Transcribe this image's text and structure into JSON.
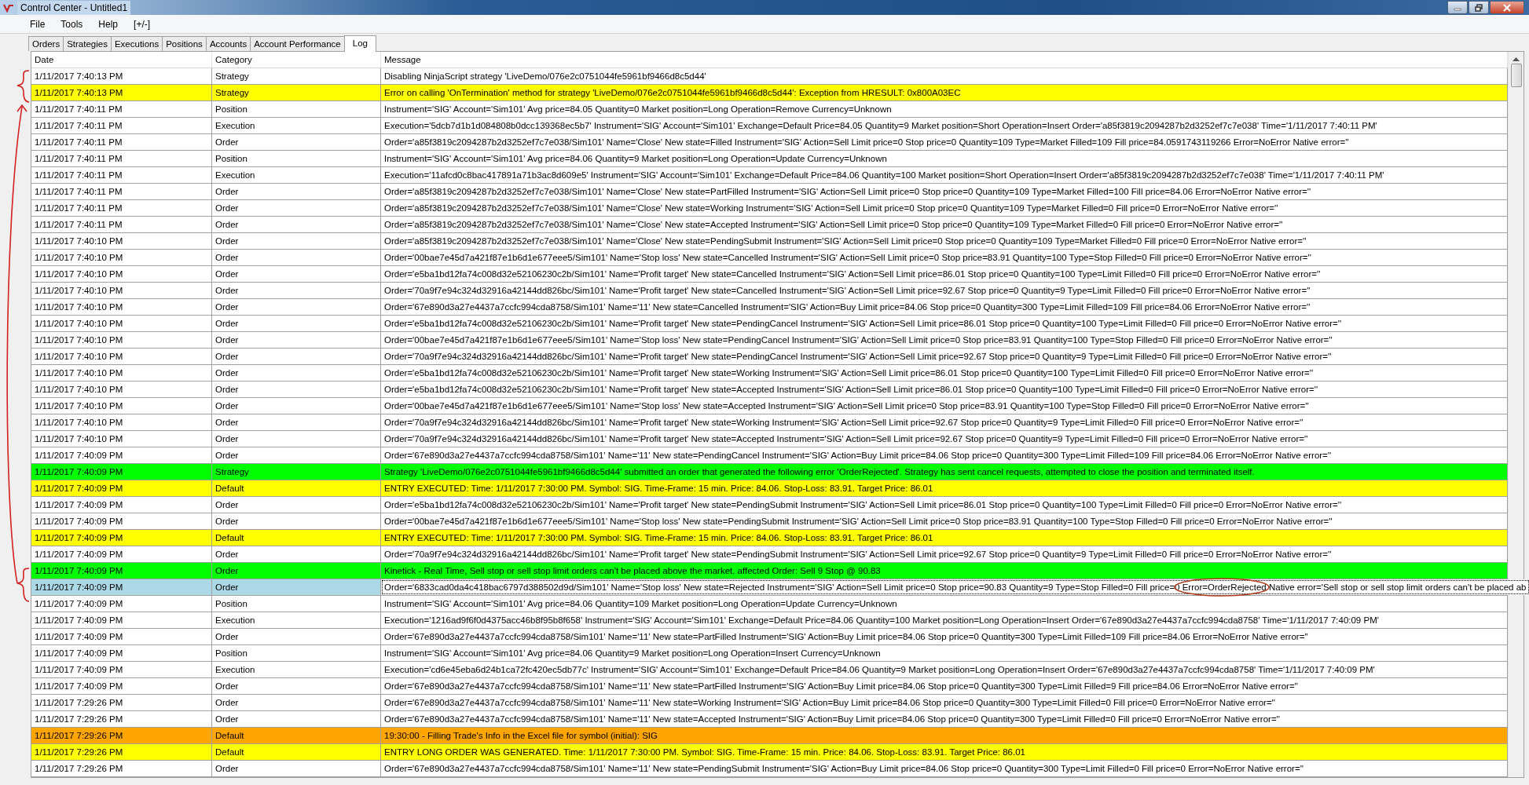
{
  "window": {
    "title": "Control Center - Untitled1"
  },
  "menu": [
    "File",
    "Tools",
    "Help",
    "[+/-]"
  ],
  "tabs": [
    {
      "label": "Orders",
      "selected": false
    },
    {
      "label": "Strategies",
      "selected": false
    },
    {
      "label": "Executions",
      "selected": false
    },
    {
      "label": "Positions",
      "selected": false
    },
    {
      "label": "Accounts",
      "selected": false
    },
    {
      "label": "Account Performance",
      "selected": false
    },
    {
      "label": "Log",
      "selected": true
    }
  ],
  "table": {
    "columns": [
      "Date",
      "Category",
      "Message"
    ],
    "rows": [
      {
        "date": "1/11/2017 7:40:13 PM",
        "category": "Strategy",
        "message": "Disabling NinjaScript strategy 'LiveDemo/076e2c0751044fe5961bf9466d8c5d44'",
        "color": "#ffffff",
        "selected": false
      },
      {
        "date": "1/11/2017 7:40:13 PM",
        "category": "Strategy",
        "message": "Error on calling 'OnTermination' method for strategy 'LiveDemo/076e2c0751044fe5961bf9466d8c5d44': Exception from HRESULT: 0x800A03EC",
        "color": "#ffff00",
        "selected": false
      },
      {
        "date": "1/11/2017 7:40:11 PM",
        "category": "Position",
        "message": "Instrument='SIG' Account='Sim101' Avg price=84.05 Quantity=0 Market position=Long Operation=Remove Currency=Unknown",
        "color": "#ffffff",
        "selected": false
      },
      {
        "date": "1/11/2017 7:40:11 PM",
        "category": "Execution",
        "message": "Execution='5dcb7d1b1d084808b0dcc139368ec5b7' Instrument='SIG' Account='Sim101' Exchange=Default Price=84.05 Quantity=9 Market position=Short Operation=Insert Order='a85f3819c2094287b2d3252ef7c7e038' Time='1/11/2017 7:40:11 PM'",
        "color": "#ffffff",
        "selected": false
      },
      {
        "date": "1/11/2017 7:40:11 PM",
        "category": "Order",
        "message": "Order='a85f3819c2094287b2d3252ef7c7e038/Sim101' Name='Close' New state=Filled Instrument='SIG' Action=Sell Limit price=0 Stop price=0 Quantity=109 Type=Market Filled=109 Fill price=84.0591743119266 Error=NoError Native error=''",
        "color": "#ffffff",
        "selected": false
      },
      {
        "date": "1/11/2017 7:40:11 PM",
        "category": "Position",
        "message": "Instrument='SIG' Account='Sim101' Avg price=84.06 Quantity=9 Market position=Long Operation=Update Currency=Unknown",
        "color": "#ffffff",
        "selected": false
      },
      {
        "date": "1/11/2017 7:40:11 PM",
        "category": "Execution",
        "message": "Execution='11afcd0c8bac417891a71b3ac8d609e5' Instrument='SIG' Account='Sim101' Exchange=Default Price=84.06 Quantity=100 Market position=Short Operation=Insert Order='a85f3819c2094287b2d3252ef7c7e038' Time='1/11/2017 7:40:11 PM'",
        "color": "#ffffff",
        "selected": false
      },
      {
        "date": "1/11/2017 7:40:11 PM",
        "category": "Order",
        "message": "Order='a85f3819c2094287b2d3252ef7c7e038/Sim101' Name='Close' New state=PartFilled Instrument='SIG' Action=Sell Limit price=0 Stop price=0 Quantity=109 Type=Market Filled=100 Fill price=84.06 Error=NoError Native error=''",
        "color": "#ffffff",
        "selected": false
      },
      {
        "date": "1/11/2017 7:40:11 PM",
        "category": "Order",
        "message": "Order='a85f3819c2094287b2d3252ef7c7e038/Sim101' Name='Close' New state=Working Instrument='SIG' Action=Sell Limit price=0 Stop price=0 Quantity=109 Type=Market Filled=0 Fill price=0 Error=NoError Native error=''",
        "color": "#ffffff",
        "selected": false
      },
      {
        "date": "1/11/2017 7:40:11 PM",
        "category": "Order",
        "message": "Order='a85f3819c2094287b2d3252ef7c7e038/Sim101' Name='Close' New state=Accepted Instrument='SIG' Action=Sell Limit price=0 Stop price=0 Quantity=109 Type=Market Filled=0 Fill price=0 Error=NoError Native error=''",
        "color": "#ffffff",
        "selected": false
      },
      {
        "date": "1/11/2017 7:40:10 PM",
        "category": "Order",
        "message": "Order='a85f3819c2094287b2d3252ef7c7e038/Sim101' Name='Close' New state=PendingSubmit Instrument='SIG' Action=Sell Limit price=0 Stop price=0 Quantity=109 Type=Market Filled=0 Fill price=0 Error=NoError Native error=''",
        "color": "#ffffff",
        "selected": false
      },
      {
        "date": "1/11/2017 7:40:10 PM",
        "category": "Order",
        "message": "Order='00bae7e45d7a421f87e1b6d1e677eee5/Sim101' Name='Stop loss' New state=Cancelled Instrument='SIG' Action=Sell Limit price=0 Stop price=83.91 Quantity=100 Type=Stop Filled=0 Fill price=0 Error=NoError Native error=''",
        "color": "#ffffff",
        "selected": false
      },
      {
        "date": "1/11/2017 7:40:10 PM",
        "category": "Order",
        "message": "Order='e5ba1bd12fa74c008d32e52106230c2b/Sim101' Name='Profit target' New state=Cancelled Instrument='SIG' Action=Sell Limit price=86.01 Stop price=0 Quantity=100 Type=Limit Filled=0 Fill price=0 Error=NoError Native error=''",
        "color": "#ffffff",
        "selected": false
      },
      {
        "date": "1/11/2017 7:40:10 PM",
        "category": "Order",
        "message": "Order='70a9f7e94c324d32916a42144dd826bc/Sim101' Name='Profit target' New state=Cancelled Instrument='SIG' Action=Sell Limit price=92.67 Stop price=0 Quantity=9 Type=Limit Filled=0 Fill price=0 Error=NoError Native error=''",
        "color": "#ffffff",
        "selected": false
      },
      {
        "date": "1/11/2017 7:40:10 PM",
        "category": "Order",
        "message": "Order='67e890d3a27e4437a7ccfc994cda8758/Sim101' Name='11' New state=Cancelled Instrument='SIG' Action=Buy Limit price=84.06 Stop price=0 Quantity=300 Type=Limit Filled=109 Fill price=84.06 Error=NoError Native error=''",
        "color": "#ffffff",
        "selected": false
      },
      {
        "date": "1/11/2017 7:40:10 PM",
        "category": "Order",
        "message": "Order='e5ba1bd12fa74c008d32e52106230c2b/Sim101' Name='Profit target' New state=PendingCancel Instrument='SIG' Action=Sell Limit price=86.01 Stop price=0 Quantity=100 Type=Limit Filled=0 Fill price=0 Error=NoError Native error=''",
        "color": "#ffffff",
        "selected": false
      },
      {
        "date": "1/11/2017 7:40:10 PM",
        "category": "Order",
        "message": "Order='00bae7e45d7a421f87e1b6d1e677eee5/Sim101' Name='Stop loss' New state=PendingCancel Instrument='SIG' Action=Sell Limit price=0 Stop price=83.91 Quantity=100 Type=Stop Filled=0 Fill price=0 Error=NoError Native error=''",
        "color": "#ffffff",
        "selected": false
      },
      {
        "date": "1/11/2017 7:40:10 PM",
        "category": "Order",
        "message": "Order='70a9f7e94c324d32916a42144dd826bc/Sim101' Name='Profit target' New state=PendingCancel Instrument='SIG' Action=Sell Limit price=92.67 Stop price=0 Quantity=9 Type=Limit Filled=0 Fill price=0 Error=NoError Native error=''",
        "color": "#ffffff",
        "selected": false
      },
      {
        "date": "1/11/2017 7:40:10 PM",
        "category": "Order",
        "message": "Order='e5ba1bd12fa74c008d32e52106230c2b/Sim101' Name='Profit target' New state=Working Instrument='SIG' Action=Sell Limit price=86.01 Stop price=0 Quantity=100 Type=Limit Filled=0 Fill price=0 Error=NoError Native error=''",
        "color": "#ffffff",
        "selected": false
      },
      {
        "date": "1/11/2017 7:40:10 PM",
        "category": "Order",
        "message": "Order='e5ba1bd12fa74c008d32e52106230c2b/Sim101' Name='Profit target' New state=Accepted Instrument='SIG' Action=Sell Limit price=86.01 Stop price=0 Quantity=100 Type=Limit Filled=0 Fill price=0 Error=NoError Native error=''",
        "color": "#ffffff",
        "selected": false
      },
      {
        "date": "1/11/2017 7:40:10 PM",
        "category": "Order",
        "message": "Order='00bae7e45d7a421f87e1b6d1e677eee5/Sim101' Name='Stop loss' New state=Accepted Instrument='SIG' Action=Sell Limit price=0 Stop price=83.91 Quantity=100 Type=Stop Filled=0 Fill price=0 Error=NoError Native error=''",
        "color": "#ffffff",
        "selected": false
      },
      {
        "date": "1/11/2017 7:40:10 PM",
        "category": "Order",
        "message": "Order='70a9f7e94c324d32916a42144dd826bc/Sim101' Name='Profit target' New state=Working Instrument='SIG' Action=Sell Limit price=92.67 Stop price=0 Quantity=9 Type=Limit Filled=0 Fill price=0 Error=NoError Native error=''",
        "color": "#ffffff",
        "selected": false
      },
      {
        "date": "1/11/2017 7:40:10 PM",
        "category": "Order",
        "message": "Order='70a9f7e94c324d32916a42144dd826bc/Sim101' Name='Profit target' New state=Accepted Instrument='SIG' Action=Sell Limit price=92.67 Stop price=0 Quantity=9 Type=Limit Filled=0 Fill price=0 Error=NoError Native error=''",
        "color": "#ffffff",
        "selected": false
      },
      {
        "date": "1/11/2017 7:40:09 PM",
        "category": "Order",
        "message": "Order='67e890d3a27e4437a7ccfc994cda8758/Sim101' Name='11' New state=PendingCancel Instrument='SIG' Action=Buy Limit price=84.06 Stop price=0 Quantity=300 Type=Limit Filled=109 Fill price=84.06 Error=NoError Native error=''",
        "color": "#ffffff",
        "selected": false
      },
      {
        "date": "1/11/2017 7:40:09 PM",
        "category": "Strategy",
        "message": "Strategy 'LiveDemo/076e2c0751044fe5961bf9466d8c5d44' submitted an order that generated the following error 'OrderRejected'. Strategy has sent cancel requests, attempted to close the position and terminated itself.",
        "color": "#00ff00",
        "selected": false
      },
      {
        "date": "1/11/2017 7:40:09 PM",
        "category": "Default",
        "message": "ENTRY EXECUTED: Time: 1/11/2017 7:30:00 PM. Symbol: SIG. Time-Frame: 15 min. Price: 84.06. Stop-Loss: 83.91. Target Price: 86.01",
        "color": "#ffff00",
        "selected": false
      },
      {
        "date": "1/11/2017 7:40:09 PM",
        "category": "Order",
        "message": "Order='e5ba1bd12fa74c008d32e52106230c2b/Sim101' Name='Profit target' New state=PendingSubmit Instrument='SIG' Action=Sell Limit price=86.01 Stop price=0 Quantity=100 Type=Limit Filled=0 Fill price=0 Error=NoError Native error=''",
        "color": "#ffffff",
        "selected": false
      },
      {
        "date": "1/11/2017 7:40:09 PM",
        "category": "Order",
        "message": "Order='00bae7e45d7a421f87e1b6d1e677eee5/Sim101' Name='Stop loss' New state=PendingSubmit Instrument='SIG' Action=Sell Limit price=0 Stop price=83.91 Quantity=100 Type=Stop Filled=0 Fill price=0 Error=NoError Native error=''",
        "color": "#ffffff",
        "selected": false
      },
      {
        "date": "1/11/2017 7:40:09 PM",
        "category": "Default",
        "message": "ENTRY EXECUTED: Time: 1/11/2017 7:30:00 PM. Symbol: SIG. Time-Frame: 15 min. Price: 84.06. Stop-Loss: 83.91. Target Price: 86.01",
        "color": "#ffff00",
        "selected": false
      },
      {
        "date": "1/11/2017 7:40:09 PM",
        "category": "Order",
        "message": "Order='70a9f7e94c324d32916a42144dd826bc/Sim101' Name='Profit target' New state=PendingSubmit Instrument='SIG' Action=Sell Limit price=92.67 Stop price=0 Quantity=9 Type=Limit Filled=0 Fill price=0 Error=NoError Native error=''",
        "color": "#ffffff",
        "selected": false
      },
      {
        "date": "1/11/2017 7:40:09 PM",
        "category": "Order",
        "message": "Kinetick - Real Time, Sell stop or sell stop limit orders can't be placed above the market. affected Order: Sell 9 Stop @ 90.83",
        "color": "#00ff00",
        "selected": false
      },
      {
        "date": "1/11/2017 7:40:09 PM",
        "category": "Order",
        "message": "Order='6833cad0da4c418bac6797d388502d9d/Sim101' Name='Stop loss' New state=Rejected Instrument='SIG' Action=Sell Limit price=0 Stop price=90.83 Quantity=9 Type=Stop Filled=0 Fill price=0 Error=OrderRejected Native error='Sell stop or sell stop limit orders can't be placed ab",
        "color": "#ffffff",
        "selected": true
      },
      {
        "date": "1/11/2017 7:40:09 PM",
        "category": "Position",
        "message": "Instrument='SIG' Account='Sim101' Avg price=84.06 Quantity=109 Market position=Long Operation=Update Currency=Unknown",
        "color": "#ffffff",
        "selected": false
      },
      {
        "date": "1/11/2017 7:40:09 PM",
        "category": "Execution",
        "message": "Execution='1216ad9f6f0d4375acc46b8f95b8f658' Instrument='SIG' Account='Sim101' Exchange=Default Price=84.06 Quantity=100 Market position=Long Operation=Insert Order='67e890d3a27e4437a7ccfc994cda8758' Time='1/11/2017 7:40:09 PM'",
        "color": "#ffffff",
        "selected": false
      },
      {
        "date": "1/11/2017 7:40:09 PM",
        "category": "Order",
        "message": "Order='67e890d3a27e4437a7ccfc994cda8758/Sim101' Name='11' New state=PartFilled Instrument='SIG' Action=Buy Limit price=84.06 Stop price=0 Quantity=300 Type=Limit Filled=109 Fill price=84.06 Error=NoError Native error=''",
        "color": "#ffffff",
        "selected": false
      },
      {
        "date": "1/11/2017 7:40:09 PM",
        "category": "Position",
        "message": "Instrument='SIG' Account='Sim101' Avg price=84.06 Quantity=9 Market position=Long Operation=Insert Currency=Unknown",
        "color": "#ffffff",
        "selected": false
      },
      {
        "date": "1/11/2017 7:40:09 PM",
        "category": "Execution",
        "message": "Execution='cd6e45eba6d24b1ca72fc420ec5db77c' Instrument='SIG' Account='Sim101' Exchange=Default Price=84.06 Quantity=9 Market position=Long Operation=Insert Order='67e890d3a27e4437a7ccfc994cda8758' Time='1/11/2017 7:40:09 PM'",
        "color": "#ffffff",
        "selected": false
      },
      {
        "date": "1/11/2017 7:40:09 PM",
        "category": "Order",
        "message": "Order='67e890d3a27e4437a7ccfc994cda8758/Sim101' Name='11' New state=PartFilled Instrument='SIG' Action=Buy Limit price=84.06 Stop price=0 Quantity=300 Type=Limit Filled=9 Fill price=84.06 Error=NoError Native error=''",
        "color": "#ffffff",
        "selected": false
      },
      {
        "date": "1/11/2017 7:29:26 PM",
        "category": "Order",
        "message": "Order='67e890d3a27e4437a7ccfc994cda8758/Sim101' Name='11' New state=Working Instrument='SIG' Action=Buy Limit price=84.06 Stop price=0 Quantity=300 Type=Limit Filled=0 Fill price=0 Error=NoError Native error=''",
        "color": "#ffffff",
        "selected": false
      },
      {
        "date": "1/11/2017 7:29:26 PM",
        "category": "Order",
        "message": "Order='67e890d3a27e4437a7ccfc994cda8758/Sim101' Name='11' New state=Accepted Instrument='SIG' Action=Buy Limit price=84.06 Stop price=0 Quantity=300 Type=Limit Filled=0 Fill price=0 Error=NoError Native error=''",
        "color": "#ffffff",
        "selected": false
      },
      {
        "date": "1/11/2017 7:29:26 PM",
        "category": "Default",
        "message": "19:30:00 - Filling Trade's Info in the Excel file for symbol (initial): SIG",
        "color": "#ffa500",
        "selected": false
      },
      {
        "date": "1/11/2017 7:29:26 PM",
        "category": "Default",
        "message": "ENTRY LONG ORDER WAS GENERATED. Time: 1/11/2017 7:30:00 PM. Symbol: SIG. Time-Frame: 15 min. Price: 84.06. Stop-Loss: 83.91. Target Price: 86.01",
        "color": "#ffff00",
        "selected": false
      },
      {
        "date": "1/11/2017 7:29:26 PM",
        "category": "Order",
        "message": "Order='67e890d3a27e4437a7ccfc994cda8758/Sim101' Name='11' New state=PendingSubmit Instrument='SIG' Action=Buy Limit price=84.06 Stop price=0 Quantity=300 Type=Limit Filled=0 Fill price=0 Error=NoError Native error=''",
        "color": "#ffffff",
        "selected": false
      }
    ]
  }
}
